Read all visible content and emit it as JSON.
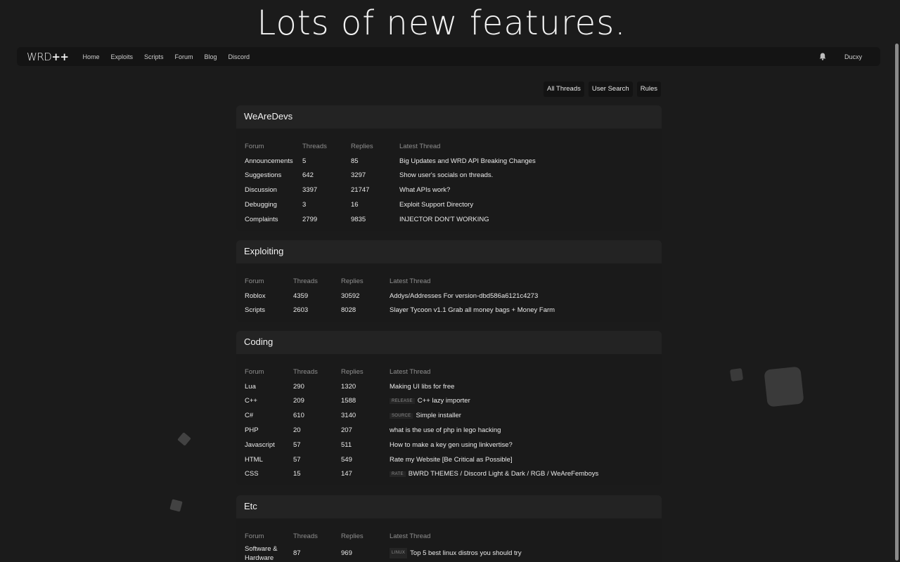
{
  "headline": "Lots of new features.",
  "navbar": {
    "logo_main": "WRD",
    "logo_suffix": "++",
    "links": [
      "Home",
      "Exploits",
      "Scripts",
      "Forum",
      "Blog",
      "Discord"
    ],
    "username": "Ducxy",
    "bell_icon": "bell-icon"
  },
  "top_buttons": [
    "All Threads",
    "User Search",
    "Rules"
  ],
  "columns": {
    "forum": "Forum",
    "threads": "Threads",
    "replies": "Replies",
    "latest": "Latest Thread"
  },
  "sections": [
    {
      "title": "WeAreDevs",
      "rows": [
        {
          "forum": "Announcements",
          "threads": "5",
          "replies": "85",
          "tag": "",
          "latest": "Big Updates and WRD API Breaking Changes"
        },
        {
          "forum": "Suggestions",
          "threads": "642",
          "replies": "3297",
          "tag": "",
          "latest": "Show user's socials on threads."
        },
        {
          "forum": "Discussion",
          "threads": "3397",
          "replies": "21747",
          "tag": "",
          "latest": "What APIs work?"
        },
        {
          "forum": "Debugging",
          "threads": "3",
          "replies": "16",
          "tag": "",
          "latest": "Exploit Support Directory"
        },
        {
          "forum": "Complaints",
          "threads": "2799",
          "replies": "9835",
          "tag": "",
          "latest": "INJECTOR DON'T WORKING"
        }
      ]
    },
    {
      "title": "Exploiting",
      "rows": [
        {
          "forum": "Roblox",
          "threads": "4359",
          "replies": "30592",
          "tag": "",
          "latest": "Addys/Addresses For version-dbd586a6121c4273"
        },
        {
          "forum": "Scripts",
          "threads": "2603",
          "replies": "8028",
          "tag": "",
          "latest": "Slayer Tycoon v1.1 Grab all money bags + Money Farm"
        }
      ]
    },
    {
      "title": "Coding",
      "rows": [
        {
          "forum": "Lua",
          "threads": "290",
          "replies": "1320",
          "tag": "",
          "latest": "Making UI libs for free"
        },
        {
          "forum": "C++",
          "threads": "209",
          "replies": "1588",
          "tag": "RELEASE",
          "latest": "C++ lazy importer"
        },
        {
          "forum": "C#",
          "threads": "610",
          "replies": "3140",
          "tag": "SOURCE",
          "latest": "Simple installer"
        },
        {
          "forum": "PHP",
          "threads": "20",
          "replies": "207",
          "tag": "",
          "latest": "what is the use of php in lego hacking"
        },
        {
          "forum": "Javascript",
          "threads": "57",
          "replies": "511",
          "tag": "",
          "latest": "How to make a key gen using linkvertise?"
        },
        {
          "forum": "HTML",
          "threads": "57",
          "replies": "549",
          "tag": "",
          "latest": "Rate my Website [Be Critical as Possible]"
        },
        {
          "forum": "CSS",
          "threads": "15",
          "replies": "147",
          "tag": "RATE",
          "latest": "BWRD THEMES / Discord Light & Dark / RGB / WeAreFemboys"
        }
      ]
    },
    {
      "title": "Etc",
      "rows": [
        {
          "forum": "Software & Hardware",
          "threads": "87",
          "replies": "969",
          "tag": "LINUX",
          "latest": "Top 5 best linux distros you should try"
        }
      ]
    }
  ]
}
